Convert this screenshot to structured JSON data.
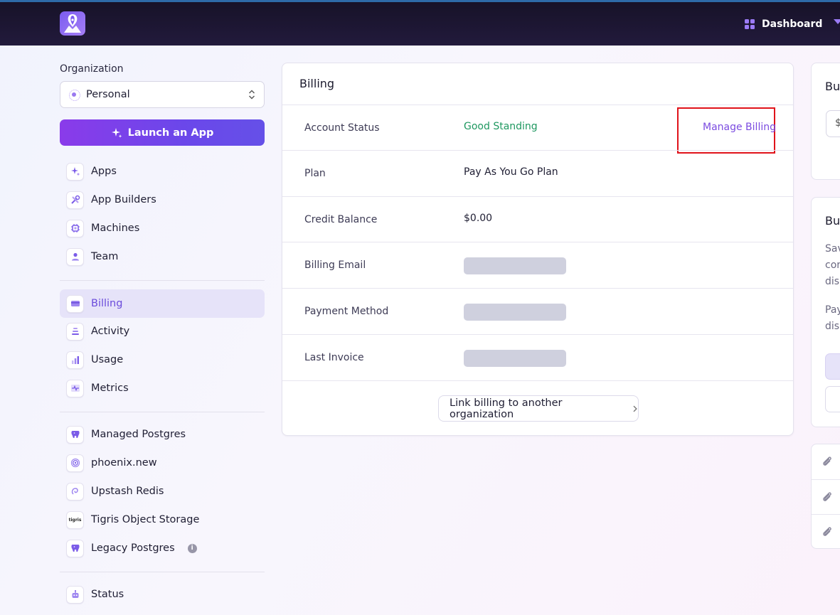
{
  "header": {
    "dashboard_label": "Dashboard",
    "logo_icon": "balloon-logo-icon"
  },
  "sidebar": {
    "org_label": "Organization",
    "org_selected": "Personal",
    "launch_label": "Launch an App",
    "items": [
      {
        "label": "Apps",
        "icon": "sparkle-icon"
      },
      {
        "label": "App Builders",
        "icon": "tools-icon"
      },
      {
        "label": "Machines",
        "icon": "chip-icon"
      },
      {
        "label": "Team",
        "icon": "user-icon"
      },
      {
        "label": "Billing",
        "icon": "card-icon",
        "active": true
      },
      {
        "label": "Activity",
        "icon": "stack-icon"
      },
      {
        "label": "Usage",
        "icon": "bar-chart-icon"
      },
      {
        "label": "Metrics",
        "icon": "pulse-icon"
      },
      {
        "label": "Managed Postgres",
        "icon": "elephant-icon"
      },
      {
        "label": "phoenix.new",
        "icon": "spiral-icon"
      },
      {
        "label": "Upstash Redis",
        "icon": "swirl-icon"
      },
      {
        "label": "Tigris Object Storage",
        "icon": "tigris-icon",
        "icon_text": "tigris"
      },
      {
        "label": "Legacy Postgres",
        "icon": "elephant-icon"
      },
      {
        "label": "Status",
        "icon": "robot-icon"
      }
    ],
    "info_glyph": "i"
  },
  "billing": {
    "title": "Billing",
    "rows": [
      {
        "label": "Account Status",
        "value": "Good Standing"
      },
      {
        "label": "Plan",
        "value": "Pay As You Go Plan"
      },
      {
        "label": "Credit Balance",
        "value": "$0.00"
      },
      {
        "label": "Billing Email",
        "value": ""
      },
      {
        "label": "Payment Method",
        "value": ""
      },
      {
        "label": "Last Invoice",
        "value": ""
      }
    ],
    "manage_label": "Manage Billing",
    "link_button_label": "Link billing to another organization"
  },
  "right_panel": {
    "card1_title": "Bu",
    "card1_input": "$",
    "card2_title": "Bu",
    "card2_lines": [
      "Sav",
      "cor",
      "disc"
    ],
    "card2_lines2": [
      "Pay",
      "disc"
    ]
  },
  "colors": {
    "accent": "#6a4bdb",
    "good": "#1f9860",
    "highlight": "#e0121a"
  }
}
